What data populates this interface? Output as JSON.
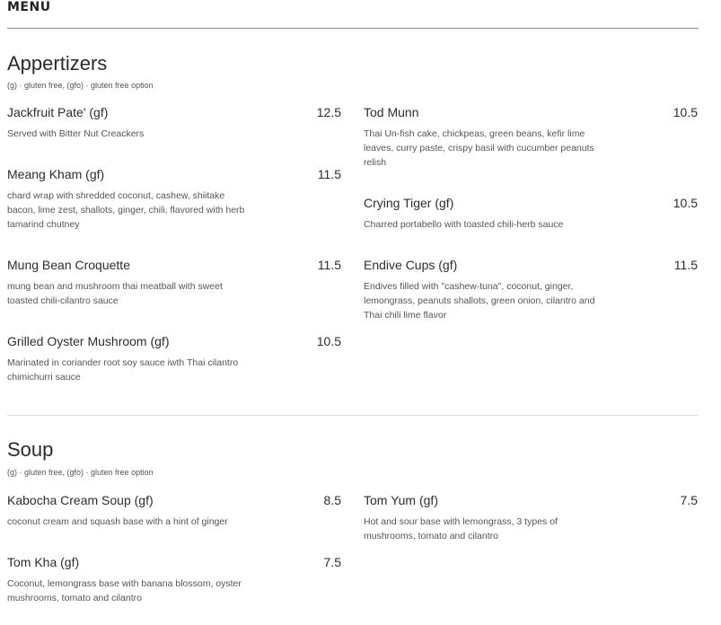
{
  "header": {
    "menu_label": "MENU"
  },
  "sections": [
    {
      "title": "Appertizers",
      "note": "(g) · gluten free, (gfo) · gluten free option",
      "items": [
        {
          "name": "Jackfruit Pate' (gf)",
          "price": "12.5",
          "desc": "Served with Bitter Nut Creackers"
        },
        {
          "name": "Tod Munn",
          "price": "10.5",
          "desc": "Thai Un-fish cake, chickpeas, green beans, kefir lime leaves, curry paste, crispy basil with cucumber peanuts relish"
        },
        {
          "name": "Meang Kham (gf)",
          "price": "11.5",
          "desc": "chard wrap with shredded coconut, cashew, shiitake bacon, lime zest, shallots, ginger, chili, flavored with herb tamarind chutney"
        },
        {
          "name": "Crying Tiger (gf)",
          "price": "10.5",
          "desc": "Charred portabello with toasted chili-herb sauce"
        },
        {
          "name": "Mung Bean Croquette",
          "price": "11.5",
          "desc": "mung bean and mushroom thai meatball with sweet toasted chili-cilantro sauce"
        },
        {
          "name": "Endive Cups (gf)",
          "price": "11.5",
          "desc": "Endives filled with \"cashew-tuna\", coconut, ginger, lemongrass, peanuts shallots, green onion, cilantro and Thai chili lime flavor"
        },
        {
          "name": "Grilled Oyster Mushroom (gf)",
          "price": "10.5",
          "desc": "Marinated in coriander root soy sauce iwth Thai cilantro chimichurri sauce"
        }
      ]
    },
    {
      "title": "Soup",
      "note": "(g) · gluten free, (gfo) · gluten free option",
      "items": [
        {
          "name": "Kabocha Cream Soup (gf)",
          "price": "8.5",
          "desc": "coconut cream and squash base with a hint of ginger"
        },
        {
          "name": "Tom Yum (gf)",
          "price": "7.5",
          "desc": "Hot and sour base with lemongrass, 3 types of mushrooms, tomato and cilantro"
        },
        {
          "name": "Tom Kha (gf)",
          "price": "7.5",
          "desc": "Coconut, lemongrass base with banana blossom, oyster mushrooms, tomato and cilantro"
        }
      ]
    }
  ]
}
